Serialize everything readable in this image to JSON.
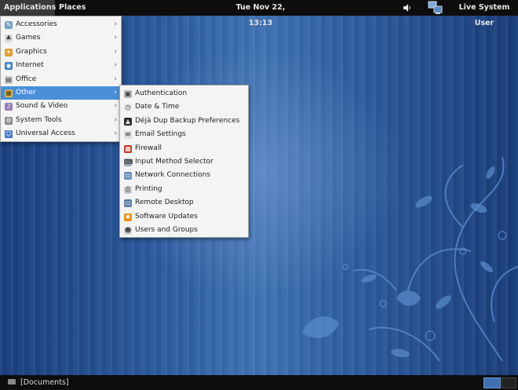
{
  "top_panel": {
    "applications": "Applications",
    "places": "Places",
    "clock": "Tue Nov 22, 13:13",
    "volume_icon": "speaker-icon",
    "network_icon": "network-computers-icon",
    "user": "Live System User"
  },
  "applications_menu": {
    "items": [
      {
        "label": "Accessories",
        "icon": "accessories-icon"
      },
      {
        "label": "Games",
        "icon": "games-icon"
      },
      {
        "label": "Graphics",
        "icon": "graphics-icon"
      },
      {
        "label": "Internet",
        "icon": "internet-globe-icon"
      },
      {
        "label": "Office",
        "icon": "office-icon"
      },
      {
        "label": "Other",
        "icon": "other-icon",
        "selected": true
      },
      {
        "label": "Sound & Video",
        "icon": "sound-video-icon"
      },
      {
        "label": "System Tools",
        "icon": "system-tools-icon"
      },
      {
        "label": "Universal Access",
        "icon": "universal-access-icon"
      }
    ]
  },
  "other_menu": {
    "items": [
      {
        "label": "Authentication",
        "icon": "authentication-icon"
      },
      {
        "label": "Date & Time",
        "icon": "clock-icon"
      },
      {
        "label": "Déjà Dup Backup Preferences",
        "icon": "backup-icon"
      },
      {
        "label": "Email Settings",
        "icon": "email-settings-icon"
      },
      {
        "label": "Firewall",
        "icon": "firewall-icon"
      },
      {
        "label": "Input Method Selector",
        "icon": "keyboard-icon"
      },
      {
        "label": "Network Connections",
        "icon": "network-icon"
      },
      {
        "label": "Printing",
        "icon": "printer-icon"
      },
      {
        "label": "Remote Desktop",
        "icon": "remote-desktop-icon"
      },
      {
        "label": "Software Updates",
        "icon": "software-updates-icon"
      },
      {
        "label": "Users and Groups",
        "icon": "users-icon"
      }
    ]
  },
  "bottom_panel": {
    "task": "[Documents]",
    "selection_color": "#4a90d9"
  }
}
